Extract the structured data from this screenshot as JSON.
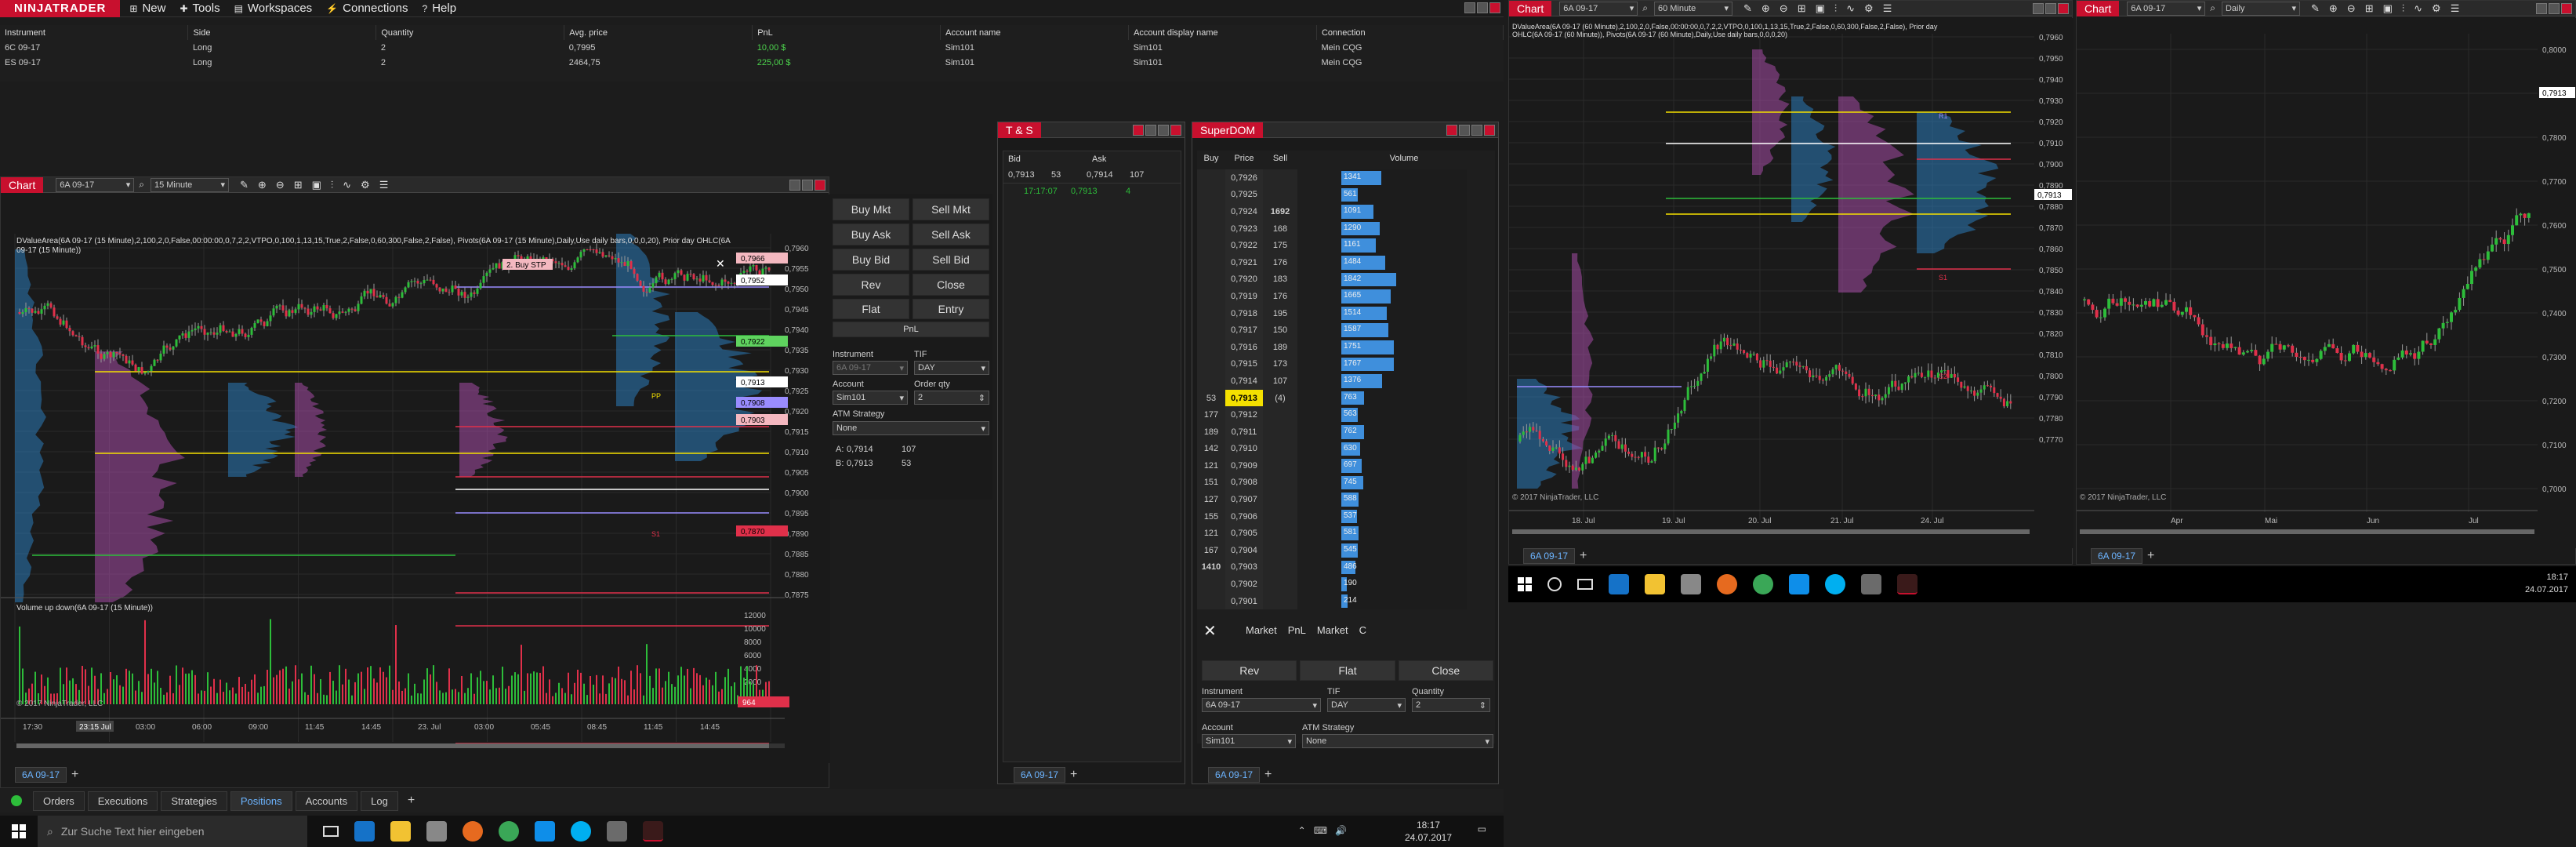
{
  "app": {
    "brand": "NINJATRADER",
    "menu": [
      {
        "label": "New",
        "icon": "new-icon"
      },
      {
        "label": "Tools",
        "icon": "tools-icon"
      },
      {
        "label": "Workspaces",
        "icon": "workspaces-icon"
      },
      {
        "label": "Connections",
        "icon": "connections-icon"
      },
      {
        "label": "Help",
        "icon": "help-icon"
      }
    ]
  },
  "positions": {
    "headers": [
      "Instrument",
      "Side",
      "Quantity",
      "Avg. price",
      "PnL",
      "Account name",
      "Account display name",
      "Connection"
    ],
    "rows": [
      {
        "instrument": "6C 09-17",
        "side": "Long",
        "qty": "2",
        "avg": "0,7995",
        "pnl": "10,00 $",
        "account": "Sim101",
        "display": "Sim101",
        "conn": "Mein CQG"
      },
      {
        "instrument": "ES 09-17",
        "side": "Long",
        "qty": "2",
        "avg": "2464,75",
        "pnl": "225,00 $",
        "account": "Sim101",
        "display": "Sim101",
        "conn": "Mein CQG"
      }
    ]
  },
  "chart1": {
    "title": "Chart",
    "instrument": "6A 09-17",
    "interval": "15 Minute",
    "info_line1": "DValueArea(6A 09-17 (15 Minute),2,100,2,0,False,00:00:00,0,7,2,2,VTPO,0,100,1,13,15,True,2,False,0,60,300,False,2,False), Pivots(6A 09-17 (15 Minute),Daily,Use daily bars,0,0,0,20), Prior day OHLC(6A",
    "info_line2": "09-17 (15 Minute))",
    "order_tag": "2. Buy STP",
    "y_labels": [
      "0,7960",
      "0,7955",
      "0,7950",
      "0,7945",
      "0,7940",
      "0,7935",
      "0,7930",
      "0,7925",
      "0,7920",
      "0,7915",
      "0,7910",
      "0,7905",
      "0,7900",
      "0,7895",
      "0,7890",
      "0,7885",
      "0,7880",
      "0,7875"
    ],
    "price_badges": [
      {
        "label": "0,7966",
        "color": "#f4b8c0"
      },
      {
        "label": "0,7952",
        "color": "#ffffff"
      },
      {
        "label": "0,7922",
        "color": "#5fd35f"
      },
      {
        "label": "0,7913",
        "color": "#ffffff"
      },
      {
        "label": "0,7908",
        "color": "#9a8cff"
      },
      {
        "label": "0,7903",
        "color": "#f4b8c0"
      },
      {
        "label": "0,7870",
        "color": "#e0304a"
      }
    ],
    "pp_label": "PP",
    "s1_label": "S1",
    "x_labels": [
      "17:30",
      "23:15",
      "03:00",
      "06:00",
      "09:00",
      "11:45",
      "14:45",
      "23. Jul",
      "03:00",
      "05:45",
      "08:45",
      "11:45",
      "14:45"
    ],
    "x_highlight": "23:15 Jul",
    "volume_title": "Volume up down(6A 09-17 (15 Minute))",
    "volume_labels": [
      "12000",
      "10000",
      "8000",
      "6000",
      "4000",
      "2000"
    ],
    "volume_badge": "964",
    "copyright": "© 2017 NinjaTrader, LLC",
    "tab": "6A 09-17"
  },
  "chart_trader": {
    "buttons": [
      "Buy Mkt",
      "Sell Mkt",
      "Buy Ask",
      "Sell Ask",
      "Buy Bid",
      "Sell Bid",
      "Rev",
      "Close"
    ],
    "flat": "Flat",
    "entry": "Entry",
    "pnl": "PnL",
    "instrument_label": "Instrument",
    "instrument_value": "6A 09-17",
    "tif_label": "TIF",
    "tif_value": "DAY",
    "account_label": "Account",
    "account_value": "Sim101",
    "qty_label": "Order qty",
    "qty_value": "2",
    "atm_label": "ATM Strategy",
    "atm_value": "None",
    "ask_line": {
      "label": "A:",
      "price": "0,7914",
      "size": "107"
    },
    "bid_line": {
      "label": "B:",
      "price": "0,7913",
      "size": "53"
    }
  },
  "bottom_tabs": {
    "items": [
      "Orders",
      "Executions",
      "Strategies",
      "Positions",
      "Accounts",
      "Log"
    ],
    "active": "Positions"
  },
  "ts": {
    "title": "T & S",
    "bid_header": "Bid",
    "ask_header": "Ask",
    "bid": "0,7913",
    "bid_size": "53",
    "ask": "0,7914",
    "ask_size": "107",
    "trade_time": "17:17:07",
    "trade_price": "0,7913",
    "trade_size": "4",
    "tab": "6A 09-17"
  },
  "dom": {
    "title": "SuperDOM",
    "headers": [
      "Buy",
      "Price",
      "Sell",
      "Volume"
    ],
    "rows": [
      {
        "buy": "",
        "price": "0,7926",
        "sell": "",
        "vol": 1341
      },
      {
        "buy": "",
        "price": "0,7925",
        "sell": "",
        "vol": 561
      },
      {
        "buy": "",
        "price": "0,7924",
        "sell": "1692",
        "vol": 1091
      },
      {
        "buy": "",
        "price": "0,7923",
        "sell": "168",
        "vol": 1290
      },
      {
        "buy": "",
        "price": "0,7922",
        "sell": "175",
        "vol": 1161
      },
      {
        "buy": "",
        "price": "0,7921",
        "sell": "176",
        "vol": 1484
      },
      {
        "buy": "",
        "price": "0,7920",
        "sell": "183",
        "vol": 1842
      },
      {
        "buy": "",
        "price": "0,7919",
        "sell": "176",
        "vol": 1665
      },
      {
        "buy": "",
        "price": "0,7918",
        "sell": "195",
        "vol": 1514
      },
      {
        "buy": "",
        "price": "0,7917",
        "sell": "150",
        "vol": 1587
      },
      {
        "buy": "",
        "price": "0,7916",
        "sell": "189",
        "vol": 1751
      },
      {
        "buy": "",
        "price": "0,7915",
        "sell": "173",
        "vol": 1767
      },
      {
        "buy": "",
        "price": "0,7914",
        "sell": "107",
        "vol": 1376
      },
      {
        "buy": "53",
        "price": "0,7913",
        "sell": "(4)",
        "vol": 763
      },
      {
        "buy": "177",
        "price": "0,7912",
        "sell": "",
        "vol": 563
      },
      {
        "buy": "189",
        "price": "0,7911",
        "sell": "",
        "vol": 762
      },
      {
        "buy": "142",
        "price": "0,7910",
        "sell": "",
        "vol": 630
      },
      {
        "buy": "121",
        "price": "0,7909",
        "sell": "",
        "vol": 697
      },
      {
        "buy": "151",
        "price": "0,7908",
        "sell": "",
        "vol": 745
      },
      {
        "buy": "127",
        "price": "0,7907",
        "sell": "",
        "vol": 588
      },
      {
        "buy": "155",
        "price": "0,7906",
        "sell": "",
        "vol": 537
      },
      {
        "buy": "121",
        "price": "0,7905",
        "sell": "",
        "vol": 581
      },
      {
        "buy": "167",
        "price": "0,7904",
        "sell": "",
        "vol": 545
      },
      {
        "buy": "1410",
        "price": "0,7903",
        "sell": "",
        "vol": 486
      },
      {
        "buy": "",
        "price": "0,7902",
        "sell": "",
        "vol": 190
      },
      {
        "buy": "",
        "price": "0,7901",
        "sell": "",
        "vol": 214
      }
    ],
    "current_price": "0,7913",
    "footer_tabs": [
      "Market",
      "PnL",
      "Market",
      "C"
    ],
    "rev": "Rev",
    "flat": "Flat",
    "close": "Close",
    "instrument_label": "Instrument",
    "instrument_value": "6A 09-17",
    "tif_label": "TIF",
    "tif_value": "DAY",
    "qty_label": "Quantity",
    "qty_value": "2",
    "account_label": "Account",
    "account_value": "Sim101",
    "atm_label": "ATM Strategy",
    "atm_value": "None",
    "tab": "6A 09-17"
  },
  "chart2": {
    "title": "Chart",
    "instrument": "6A 09-17",
    "interval": "60 Minute",
    "info_line1": "DValueArea(6A 09-17 (60 Minute),2,100,2,0,False,00:00:00,0,7,2,2,VTPO,0,100,1,13,15,True,2,False,0,60,300,False,2,False), Prior day",
    "info_line2": "OHLC(6A 09-17 (60 Minute)), Pivots(6A 09-17 (60 Minute),Daily,Use daily bars,0,0,0,20)",
    "y_labels": [
      "0,7960",
      "0,7950",
      "0,7940",
      "0,7930",
      "0,7920",
      "0,7910",
      "0,7900",
      "0,7890",
      "0,7880",
      "0,7870",
      "0,7860",
      "0,7850",
      "0,7840",
      "0,7830",
      "0,7820",
      "0,7810",
      "0,7800",
      "0,7790",
      "0,7780",
      "0,7770"
    ],
    "current_badge": "0,7913",
    "x_labels": [
      "18. Jul",
      "19. Jul",
      "20. Jul",
      "21. Jul",
      "24. Jul"
    ],
    "copyright": "© 2017 NinjaTrader, LLC",
    "r1": "R1",
    "s1": "S1",
    "s2": "S2",
    "tab": "6A 09-17"
  },
  "chart3": {
    "title": "Chart",
    "instrument": "6A 09-17",
    "interval": "Daily",
    "y_labels": [
      "0,8000",
      "0,7913",
      "0,7800",
      "0,7700",
      "0,7600",
      "0,7500",
      "0,7400",
      "0,7300",
      "0,7200",
      "0,7100",
      "0,7000"
    ],
    "current_badge": "0,7913",
    "x_labels": [
      "Apr",
      "Mai",
      "Jun",
      "Jul"
    ],
    "copyright": "© 2017 NinjaTrader, LLC",
    "tab": "6A 09-17"
  },
  "taskbar_left": {
    "search_placeholder": "Zur Suche Text hier eingeben",
    "time": "18:17",
    "date": "24.07.2017"
  },
  "taskbar_right": {
    "time": "18:17",
    "date": "24.07.2017"
  }
}
